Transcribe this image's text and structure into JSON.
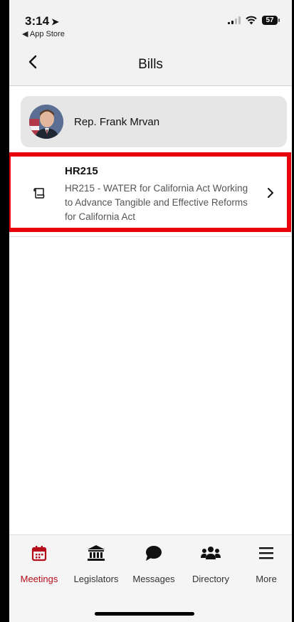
{
  "status_bar": {
    "time": "3:14",
    "back_to_app": "◀ App Store",
    "battery_level": "57"
  },
  "header": {
    "title": "Bills"
  },
  "legislator": {
    "name": "Rep. Frank Mrvan"
  },
  "bill": {
    "code": "HR215",
    "description": "HR215 - WATER for California Act Working to Advance Tangible and Effective Reforms for California Act"
  },
  "tabs": [
    {
      "label": "Meetings",
      "icon": "calendar-icon",
      "active": true
    },
    {
      "label": "Legislators",
      "icon": "capitol-icon",
      "active": false
    },
    {
      "label": "Messages",
      "icon": "chat-bubble-icon",
      "active": false
    },
    {
      "label": "Directory",
      "icon": "people-icon",
      "active": false
    },
    {
      "label": "More",
      "icon": "menu-icon",
      "active": false
    }
  ],
  "colors": {
    "accent": "#b50d1a",
    "highlight": "#e8000b"
  }
}
